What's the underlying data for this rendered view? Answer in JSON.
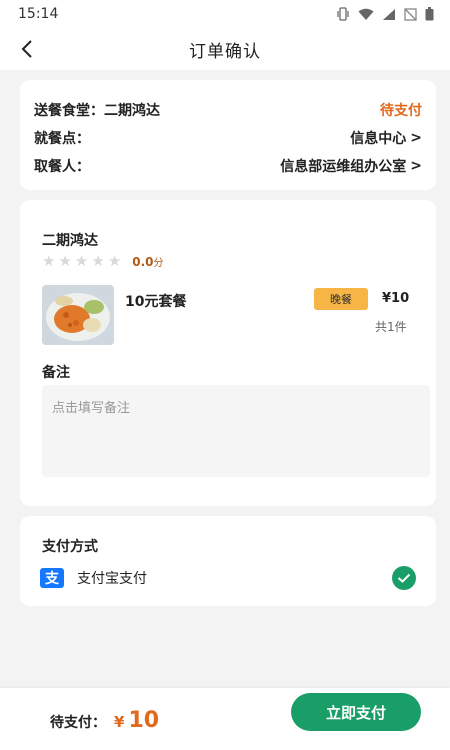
{
  "status_bar": {
    "time": "15:14",
    "icons": [
      "vibrate-icon",
      "wifi-icon",
      "signal-icon",
      "no-sim-icon",
      "battery-icon"
    ]
  },
  "header": {
    "title": "订单确认",
    "back_icon": "back-arrow-icon"
  },
  "order_info": {
    "canteen_label": "送餐食堂：",
    "canteen_value": "二期鸿达",
    "status": "待支付",
    "pickup_point_label": "就餐点：",
    "pickup_point_value": "信息中心",
    "receiver_label": "取餐人：",
    "receiver_value": "信息部运维组办公室",
    "chevron": ">"
  },
  "order_detail": {
    "shop_name": "二期鸿达",
    "rating_stars": 0,
    "rating_max": 5,
    "score": "0.0",
    "score_unit": "分",
    "item": {
      "name": "10元套餐",
      "meal_tag": "晚餐",
      "price": "¥10",
      "count": "共1件"
    },
    "remark_label": "备注",
    "remark_placeholder": "点击填写备注"
  },
  "payment": {
    "title": "支付方式",
    "method_icon_text": "支",
    "method_name": "支付宝支付",
    "selected": true
  },
  "footer": {
    "total_label": "待支付：",
    "currency": "¥",
    "amount": "10",
    "pay_button": "立即支付"
  },
  "colors": {
    "accent_green": "#1a9e67",
    "accent_orange": "#e2681b",
    "tag_yellow": "#f6b544",
    "alipay_blue": "#1677ff"
  }
}
